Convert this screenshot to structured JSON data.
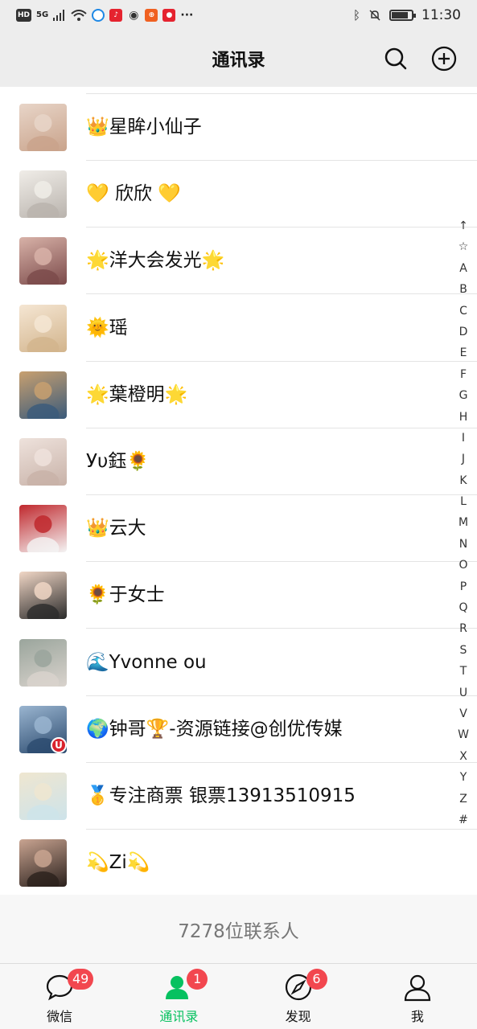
{
  "status_bar": {
    "hd": "HD",
    "network": "5G",
    "time": "11:30",
    "battery_level": 0.85
  },
  "header": {
    "title": "通讯录"
  },
  "contacts": [
    {
      "name": "👑星眸小仙子",
      "avatar_colors": [
        "#c9a38b",
        "#e8d5c8"
      ]
    },
    {
      "name": "💛  欣欣 💛",
      "avatar_colors": [
        "#b9b3ad",
        "#f0ede8"
      ]
    },
    {
      "name": "🌟洋大会发光🌟",
      "avatar_colors": [
        "#7b4a4a",
        "#d8b2a8"
      ]
    },
    {
      "name": "🌞瑶",
      "avatar_colors": [
        "#d2b48c",
        "#f5e6d3"
      ]
    },
    {
      "name": "🌟葉橙明🌟",
      "avatar_colors": [
        "#3a5a7a",
        "#c8a070"
      ]
    },
    {
      "name": "Уυ鈺🌻",
      "avatar_colors": [
        "#c8b2a8",
        "#eee2dc"
      ]
    },
    {
      "name": "👑云大",
      "avatar_colors": [
        "#f4f4f4",
        "#c0282d"
      ]
    },
    {
      "name": "🌻于女士",
      "avatar_colors": [
        "#2a2a2a",
        "#f1d7c6"
      ]
    },
    {
      "name": "🌊Yvonne ou",
      "avatar_colors": [
        "#d9d3cd",
        "#9aa59c"
      ]
    },
    {
      "name": "🌍钟哥🏆-资源链接@创优传媒",
      "avatar_colors": [
        "#2b4a6e",
        "#9ab5d0"
      ],
      "badge": "U"
    },
    {
      "name": "🥇专注商票 银票13913510915",
      "avatar_colors": [
        "#cde3ea",
        "#efe6d0"
      ]
    },
    {
      "name": "💫Zi💫",
      "avatar_colors": [
        "#2a201c",
        "#c9a491"
      ]
    }
  ],
  "alpha_index": [
    "↑",
    "☆",
    "A",
    "B",
    "C",
    "D",
    "E",
    "F",
    "G",
    "H",
    "I",
    "J",
    "K",
    "L",
    "M",
    "N",
    "O",
    "P",
    "Q",
    "R",
    "S",
    "T",
    "U",
    "V",
    "W",
    "X",
    "Y",
    "Z",
    "#"
  ],
  "footer": {
    "contact_count": "7278位联系人"
  },
  "tabs": [
    {
      "label": "微信",
      "badge": "49",
      "icon": "chat-icon",
      "active": false
    },
    {
      "label": "通讯录",
      "badge": "1",
      "icon": "contacts-icon",
      "active": true
    },
    {
      "label": "发现",
      "badge": "6",
      "icon": "compass-icon",
      "active": false
    },
    {
      "label": "我",
      "badge": "",
      "icon": "person-icon",
      "active": false
    }
  ],
  "colors": {
    "accent": "#07c160",
    "badge": "#f2474f",
    "header_bg": "#ededed"
  }
}
